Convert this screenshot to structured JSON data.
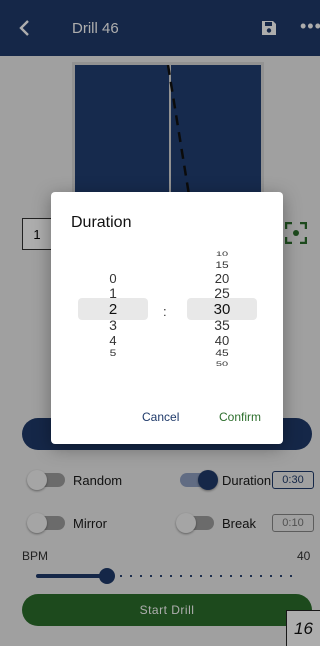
{
  "app_bar": {
    "title": "Drill 46",
    "back_icon": "chevron-left-icon",
    "save_icon": "save-icon",
    "more_icon": "more-horizontal-icon"
  },
  "side_box_value": "1",
  "options": {
    "random_label": "Random",
    "random_on": false,
    "duration_label": "Duration",
    "duration_on": true,
    "duration_value": "0:30",
    "mirror_label": "Mirror",
    "mirror_on": false,
    "break_label": "Break",
    "break_on": false,
    "break_value": "0:10"
  },
  "bpm": {
    "label": "BPM",
    "value": "40",
    "slider_fraction": 0.27
  },
  "start_button": "Start Drill",
  "page_tag": "16",
  "dialog": {
    "title": "Duration",
    "minutes": [
      "0",
      "1",
      "2",
      "3",
      "4",
      "5"
    ],
    "minutes_selected": "2",
    "seconds": [
      "10",
      "15",
      "20",
      "25",
      "30",
      "35",
      "40",
      "45",
      "50"
    ],
    "seconds_selected": "30",
    "separator": ":",
    "cancel": "Cancel",
    "confirm": "Confirm"
  },
  "colors": {
    "primary": "#1f3a6a",
    "green": "#2c6e2c"
  }
}
